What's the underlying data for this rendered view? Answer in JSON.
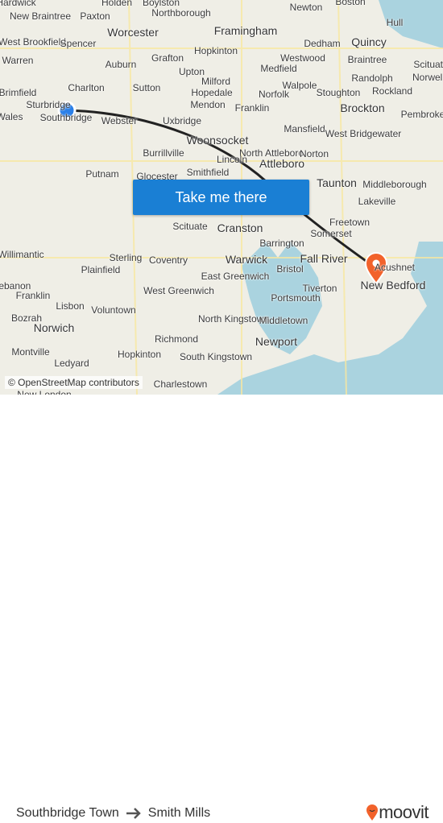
{
  "map": {
    "labels": [
      "Hardwick",
      "Holden",
      "Boylston",
      "Newton",
      "Boston",
      "Paxton",
      "Northborough",
      "New Braintree",
      "Hull",
      "Worcester",
      "Framingham",
      "West Brookfield",
      "Spencer",
      "Dedham",
      "Quincy",
      "Warren",
      "Auburn",
      "Grafton",
      "Hopkinton",
      "Westwood",
      "Braintree",
      "Scituate",
      "Medfield",
      "Upton",
      "Norwell",
      "Charlton",
      "Sutton",
      "Milford",
      "Walpole",
      "Randolph",
      "Brimfield",
      "Hopedale",
      "Norfolk",
      "Stoughton",
      "Rockland",
      "Sturbridge",
      "Mendon",
      "Franklin",
      "Brockton",
      "Wales",
      "Southbridge",
      "Webster",
      "Uxbridge",
      "Pembroke",
      "Mansfield",
      "West Bridgewater",
      "Woonsocket",
      "North Attleboro",
      "Norton",
      "Burrillville",
      "Lincoln",
      "Putnam",
      "Glocester",
      "Smithfield",
      "Attleboro",
      "Taunton",
      "Middleborough",
      "Lakeville",
      "Freetown",
      "Somerset",
      "Scituate",
      "Cranston",
      "Barrington",
      "Sterling",
      "Coventry",
      "Warwick",
      "Fall River",
      "Acushnet",
      "Willimantic",
      "Plainfield",
      "East Greenwich",
      "Bristol",
      "Lebanon",
      "West Greenwich",
      "Tiverton",
      "New Bedford",
      "Franklin",
      "Portsmouth",
      "Lisbon",
      "Voluntown",
      "Bozrah",
      "North Kingstown",
      "Middletown",
      "Norwich",
      "Richmond",
      "Newport",
      "Montville",
      "Hopkinton",
      "South Kingstown",
      "Ledyard",
      "Charlestown",
      "New London"
    ],
    "attribution": "© OpenStreetMap contributors",
    "cta_label": "Take me there",
    "origin_marker_color": "#2a7fe8",
    "destination_marker_color": "#f2622b",
    "water_color": "#aad3df"
  },
  "footer": {
    "origin": "Southbridge Town",
    "arrow_icon": "arrow-right-icon",
    "destination": "Smith Mills",
    "brand": "moovit",
    "brand_color": "#f2622b"
  }
}
